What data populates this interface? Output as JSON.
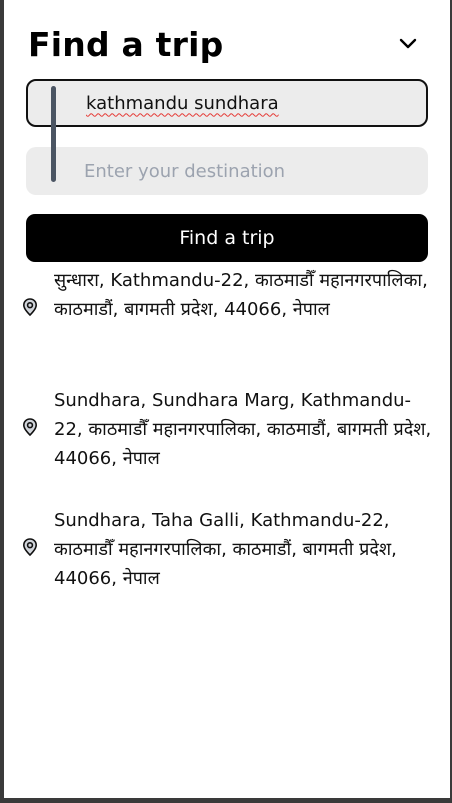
{
  "header": {
    "title": "Find a trip",
    "collapse_icon": "chevron-down-icon"
  },
  "search": {
    "origin_value": "kathmandu sundhara",
    "destination_placeholder": "Enter your destination",
    "submit_label": "Find a trip"
  },
  "results": [
    {
      "address": "सुन्धारा, Kathmandu-22, काठमाडौँ महानगरपालिका, काठमाडौं, बागमती प्रदेश, 44066, नेपाल",
      "icon": "location-pin-icon"
    },
    {
      "address": "Sundhara, Sundhara Marg, Kathmandu-22, काठमाडौँ महानगरपालिका, काठमाडौं, बागमती प्रदेश, 44066, नेपाल",
      "icon": "location-pin-icon"
    },
    {
      "address": "Sundhara, Taha Galli, Kathmandu-22, काठमाडौँ महानगरपालिका, काठमाडौं, बागमती प्रदेश, 44066, नेपाल",
      "icon": "location-pin-icon"
    }
  ]
}
